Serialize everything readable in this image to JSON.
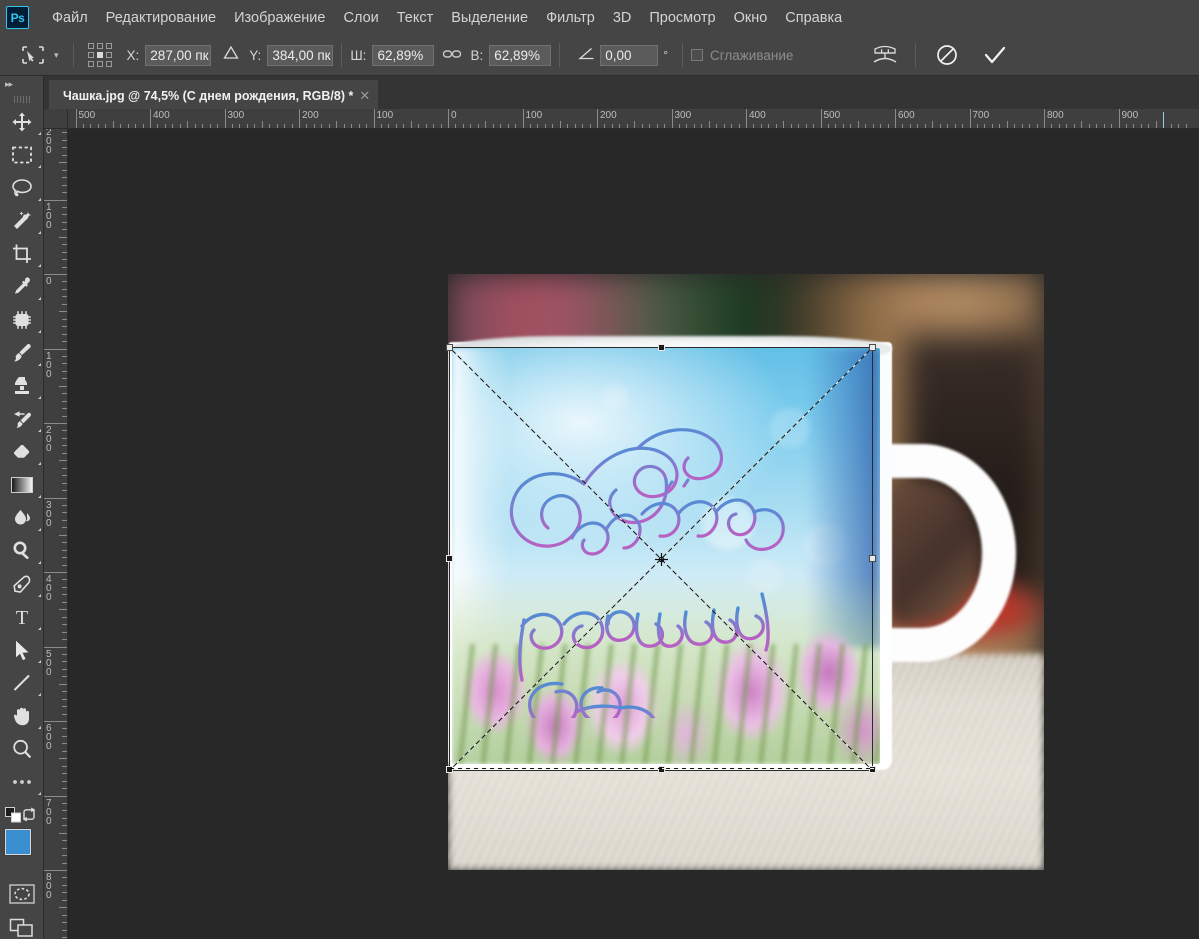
{
  "app": {
    "name": "Adobe Photoshop",
    "logo_text": "Ps",
    "logo_color": "#31c5f0",
    "logo_bg": "#001e36"
  },
  "menubar": {
    "items": [
      {
        "label": "Файл",
        "name": "menu-file"
      },
      {
        "label": "Редактирование",
        "name": "menu-edit"
      },
      {
        "label": "Изображение",
        "name": "menu-image"
      },
      {
        "label": "Слои",
        "name": "menu-layers"
      },
      {
        "label": "Текст",
        "name": "menu-type"
      },
      {
        "label": "Выделение",
        "name": "menu-select"
      },
      {
        "label": "Фильтр",
        "name": "menu-filter"
      },
      {
        "label": "3D",
        "name": "menu-3d"
      },
      {
        "label": "Просмотр",
        "name": "menu-view"
      },
      {
        "label": "Окно",
        "name": "menu-window"
      },
      {
        "label": "Справка",
        "name": "menu-help"
      }
    ]
  },
  "options_bar": {
    "active_tool_icon": "free-transform-icon",
    "reference_point": {
      "selected_index": 4,
      "cells": 9
    },
    "x_label": "X:",
    "x_value": "287,00 пк",
    "delta_icon": "delta-relative-icon",
    "y_label": "Y:",
    "y_value": "384,00 пк",
    "width_label": "Ш:",
    "width_value": "62,89%",
    "link_icon": "chain-link-icon",
    "height_label": "В:",
    "height_value": "62,89%",
    "angle_icon": "angle-icon",
    "angle_value": "0,00",
    "angle_unit": "°",
    "antialias_label": "Сглаживание",
    "antialias_checked": false,
    "antialias_disabled": true,
    "warp_icon": "warp-mode-icon",
    "cancel_icon": "cancel-transform-icon",
    "commit_icon": "commit-transform-icon"
  },
  "document_tab": {
    "title": "Чашка.jpg @ 74,5% (С днем рождения, RGB/8) *",
    "close_icon": "close-icon"
  },
  "toolbar": {
    "collapse_icon": "double-chevron-right-icon",
    "tools": [
      {
        "name": "move-tool",
        "icon": "move-icon",
        "has_flyout": true,
        "selected": false
      },
      {
        "name": "rectangular-marquee-tool",
        "icon": "marquee-icon",
        "has_flyout": true,
        "selected": false
      },
      {
        "name": "lasso-tool",
        "icon": "lasso-icon",
        "has_flyout": true,
        "selected": false
      },
      {
        "name": "quick-selection-tool",
        "icon": "magic-wand-icon",
        "has_flyout": true,
        "selected": false
      },
      {
        "name": "crop-tool",
        "icon": "crop-icon",
        "has_flyout": true,
        "selected": false
      },
      {
        "name": "eyedropper-tool",
        "icon": "eyedropper-icon",
        "has_flyout": true,
        "selected": false
      },
      {
        "name": "spot-healing-tool",
        "icon": "healing-patch-icon",
        "has_flyout": true,
        "selected": false
      },
      {
        "name": "brush-tool",
        "icon": "brush-icon",
        "has_flyout": true,
        "selected": false
      },
      {
        "name": "clone-stamp-tool",
        "icon": "stamp-icon",
        "has_flyout": true,
        "selected": false
      },
      {
        "name": "history-brush-tool",
        "icon": "history-brush-icon",
        "has_flyout": true,
        "selected": false
      },
      {
        "name": "eraser-tool",
        "icon": "eraser-icon",
        "has_flyout": true,
        "selected": false
      },
      {
        "name": "gradient-tool",
        "icon": "gradient-icon",
        "has_flyout": true,
        "selected": false
      },
      {
        "name": "blur-tool",
        "icon": "blur-drop-icon",
        "has_flyout": true,
        "selected": false
      },
      {
        "name": "dodge-tool",
        "icon": "dodge-icon",
        "has_flyout": true,
        "selected": false
      },
      {
        "name": "pen-tool",
        "icon": "pen-icon",
        "has_flyout": true,
        "selected": false
      },
      {
        "name": "type-tool",
        "icon": "text-t-icon",
        "has_flyout": true,
        "selected": false
      },
      {
        "name": "path-selection-tool",
        "icon": "arrow-pointer-icon",
        "has_flyout": true,
        "selected": false
      },
      {
        "name": "line-shape-tool",
        "icon": "line-icon",
        "has_flyout": true,
        "selected": false
      },
      {
        "name": "hand-tool",
        "icon": "hand-icon",
        "has_flyout": true,
        "selected": false
      },
      {
        "name": "zoom-tool",
        "icon": "magnifier-icon",
        "has_flyout": false,
        "selected": false
      },
      {
        "name": "edit-toolbar",
        "icon": "ellipsis-icon",
        "has_flyout": true,
        "selected": false
      }
    ],
    "foreground_color": "#3a8fd0",
    "background_color": "#ffffff",
    "default-colors-icon": "default-colors-icon",
    "swap-colors-icon": "swap-colors-icon",
    "quickmask_icon": "quick-mask-icon",
    "screenmode_icon": "screen-mode-icon"
  },
  "rulers": {
    "unit": "px",
    "horizontal_labels": [
      "500",
      "400",
      "300",
      "200",
      "100",
      "0",
      "100",
      "200",
      "300",
      "400",
      "500",
      "600",
      "700",
      "800",
      "900"
    ],
    "vertical_labels": [
      "200",
      "100",
      "0",
      "100",
      "200",
      "300",
      "400",
      "500",
      "600",
      "700",
      "800"
    ]
  },
  "canvas": {
    "zoom": "74,5%",
    "document_name": "Чашка.jpg",
    "layer_name": "С днем рождения",
    "color_mode": "RGB/8",
    "artwork_text_line1": "С днём",
    "artwork_text_line2": "рождения!",
    "artwork_description": "Белая чашка с надписью «С днём рождения!» и крокусами",
    "transform": {
      "active": true,
      "handles": 8,
      "center_point_icon": "transform-center-icon",
      "diagonals": true
    }
  }
}
